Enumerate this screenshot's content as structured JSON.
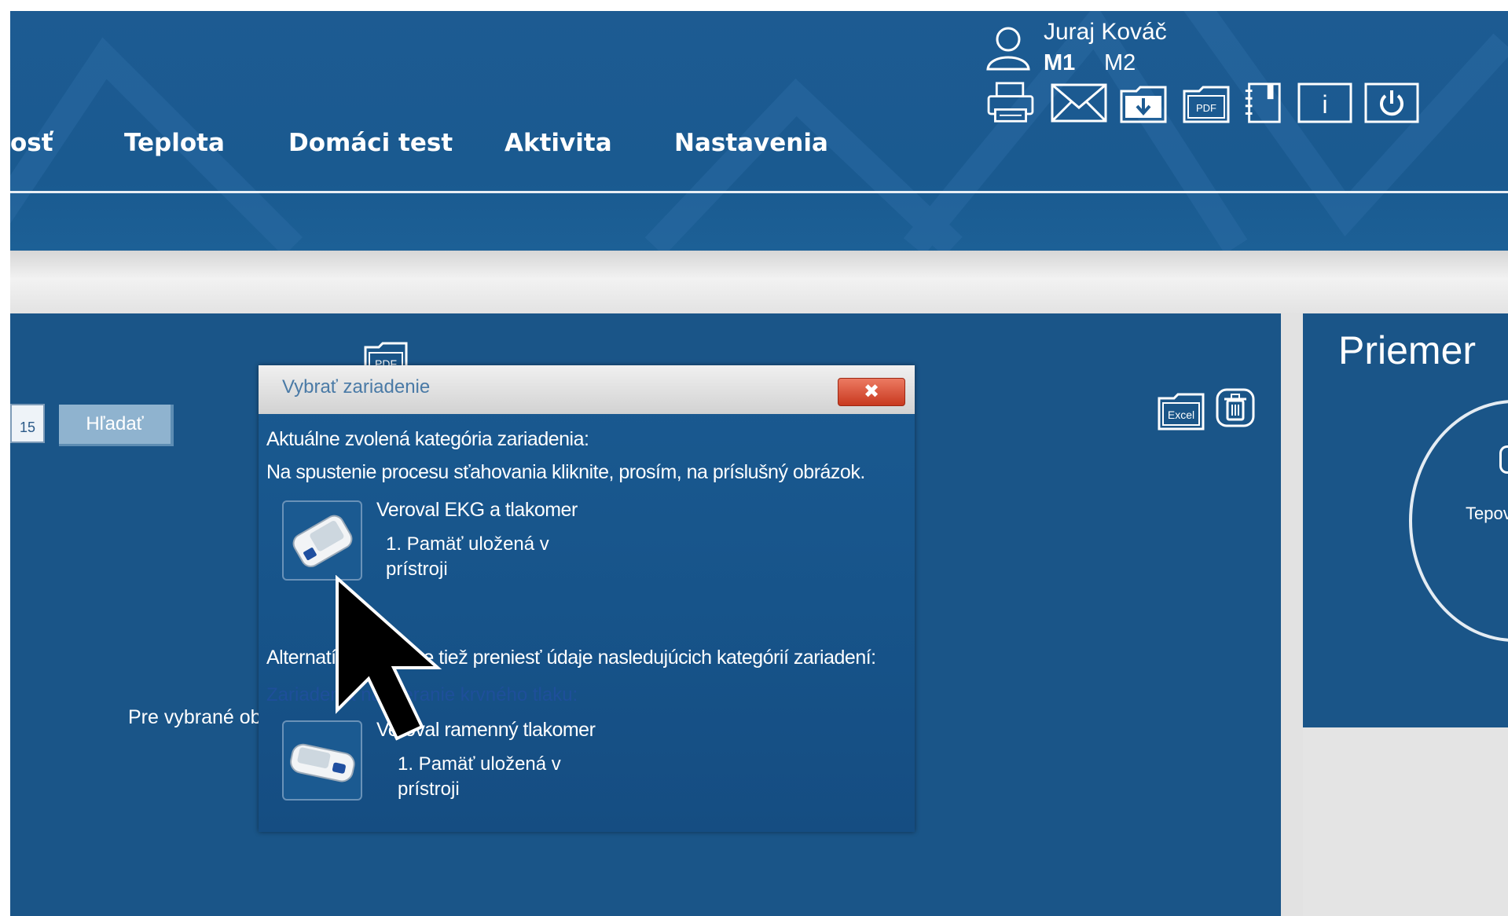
{
  "user": {
    "name": "Juraj Kováč",
    "mode_active": "M1",
    "mode_other": "M2"
  },
  "nav": {
    "items": [
      {
        "label": "osť"
      },
      {
        "label": "Teplota"
      },
      {
        "label": "Domáci test"
      },
      {
        "label": "Aktivita"
      },
      {
        "label": "Nastavenia"
      }
    ]
  },
  "toolbar": {
    "icons": [
      "printer-icon",
      "mail-icon",
      "download-icon",
      "pdf-icon",
      "notebook-icon",
      "info-icon",
      "power-icon"
    ],
    "pdf_label": "PDF",
    "info_label": "i"
  },
  "search": {
    "calendar_day": "15",
    "button_label": "Hľadať"
  },
  "main": {
    "pdf_label": "PDF",
    "excel_label": "Excel",
    "selection_text": "Pre vybrané ob"
  },
  "side": {
    "title": "Priemer",
    "circle_label": "Tepov"
  },
  "dialog": {
    "title": "Vybrať zariadenie",
    "close_label": "✖",
    "current_category": "Aktuálne zvolená kategória zariadenia:",
    "instruction": "Na spustenie procesu sťahovania kliknite, prosím, na príslušný obrázok.",
    "devices_current": [
      {
        "name": "Veroval EKG a tlakomer",
        "memory": "1. Pamäť uložená v prístroji"
      }
    ],
    "alternative_text": "Alternatívne môžete tiež preniesť údaje nasledujúcich kategórií zariadení:",
    "alternative_category": "Zariadenia na meranie krvného tlaku:",
    "devices_alternative": [
      {
        "name": "Veroval ramenný tlakomer",
        "memory": "1. Pamäť uložená v prístroji"
      }
    ]
  },
  "colors": {
    "header": "#1d5b92",
    "main": "#1a5588",
    "button": "#8fb3cf",
    "close": "#c8391f"
  }
}
